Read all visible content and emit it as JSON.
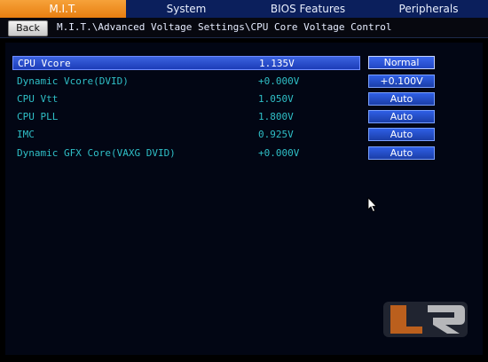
{
  "tabs": [
    {
      "label": "M.I.T."
    },
    {
      "label": "System"
    },
    {
      "label": "BIOS Features"
    },
    {
      "label": "Peripherals"
    }
  ],
  "navigation": {
    "back_label": "Back",
    "breadcrumb": "M.I.T.\\Advanced Voltage Settings\\CPU Core Voltage Control"
  },
  "settings": [
    {
      "label": "CPU Vcore",
      "value": "1.135V",
      "option": "Normal"
    },
    {
      "label": "Dynamic Vcore(DVID)",
      "value": "+0.000V",
      "option": "+0.100V"
    },
    {
      "label": "CPU Vtt",
      "value": "1.050V",
      "option": "Auto"
    },
    {
      "label": "CPU PLL",
      "value": "1.800V",
      "option": "Auto"
    },
    {
      "label": "IMC",
      "value": "0.925V",
      "option": "Auto"
    },
    {
      "label": "Dynamic GFX Core(VAXG DVID)",
      "value": "+0.000V",
      "option": "Auto"
    }
  ],
  "colors": {
    "active_tab": "#f39a2a",
    "label_text": "#2fbfc7",
    "selected_row": "#2a4fd0",
    "option_button": "#2452d4"
  },
  "icons": [
    "mouse-pointer-icon",
    "watermark-logo"
  ]
}
